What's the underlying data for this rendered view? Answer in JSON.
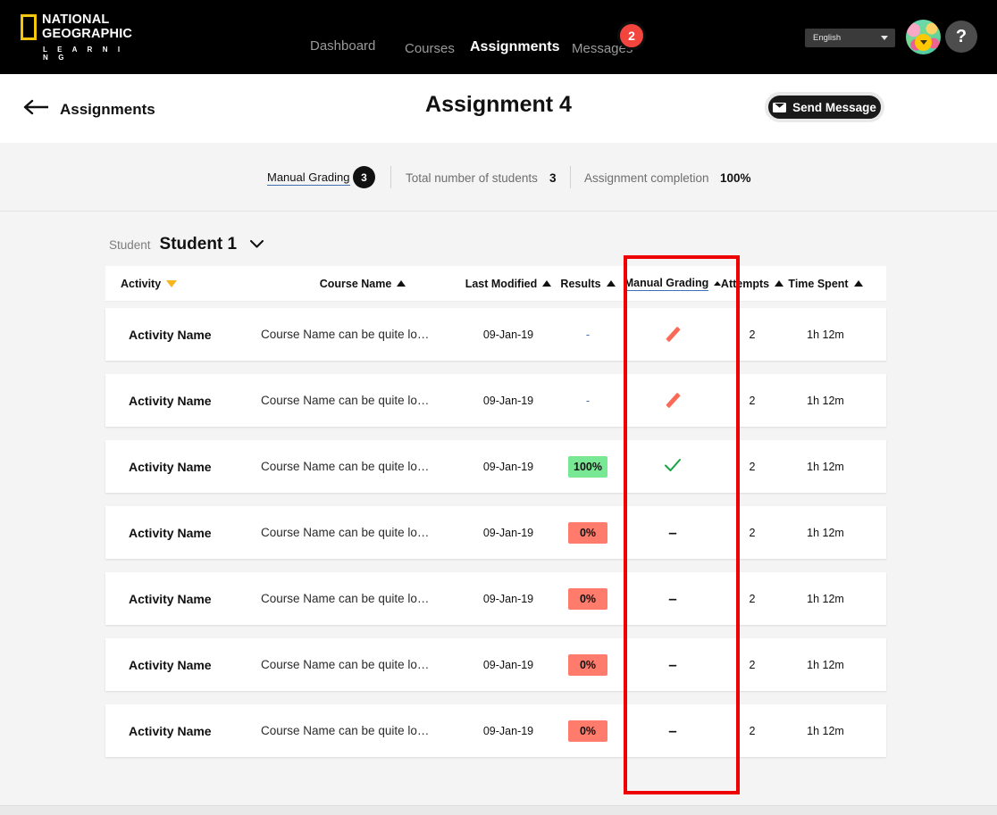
{
  "topnav": {
    "logo": {
      "line1": "NATIONAL",
      "line2": "GEOGRAPHIC",
      "line3": "L E A R N I N G",
      "mark": "ng-logo-icon"
    },
    "links": [
      {
        "label": "Dashboard",
        "active": false
      },
      {
        "label": "Courses",
        "active": false
      },
      {
        "label": "Assignments",
        "active": true
      },
      {
        "label": "Messages",
        "active": false
      }
    ],
    "messages_badge": "2",
    "language": {
      "value": "English",
      "caret": "chevron-down-icon"
    },
    "avatar": {
      "name": "user-avatar",
      "caret": "chevron-down-icon"
    },
    "help": "?"
  },
  "subheader": {
    "back_icon": "arrow-left-icon",
    "back_label": "Assignments",
    "title": "Assignment 4",
    "send_message": {
      "label": "Send Message",
      "icon": "envelope-icon"
    }
  },
  "stats": {
    "manual_grading_label": "Manual Grading",
    "manual_grading_count": "3",
    "total_students_label": "Total number of students",
    "total_students_value": "3",
    "completion_label": "Assignment completion",
    "completion_value": "100%"
  },
  "student_selector": {
    "label": "Student",
    "value": "Student 1",
    "caret": "chevron-down-icon"
  },
  "table": {
    "columns": [
      {
        "label": "Activity",
        "sort": "desc",
        "sort_icon": "triangle-down-icon"
      },
      {
        "label": "Course Name",
        "sort": "asc",
        "sort_icon": "triangle-up-icon"
      },
      {
        "label": "Last Modified",
        "sort": "asc",
        "sort_icon": "triangle-up-icon"
      },
      {
        "label": "Results",
        "sort": "asc",
        "sort_icon": "triangle-up-icon"
      },
      {
        "label": "Manual Grading",
        "sort": "asc",
        "sort_icon": "triangle-up-icon"
      },
      {
        "label": "Attempts",
        "sort": "asc",
        "sort_icon": "triangle-up-icon"
      },
      {
        "label": "Time Spent",
        "sort": "asc",
        "sort_icon": "triangle-up-icon"
      }
    ],
    "rows": [
      {
        "activity": "Activity Name",
        "course": "Course Name can be quite lo…",
        "modified": "09-Jan-19",
        "results": "-",
        "results_type": "dash",
        "manual": "pencil-icon",
        "manual_type": "pencil",
        "attempts": "2",
        "time": "1h 12m"
      },
      {
        "activity": "Activity Name",
        "course": "Course Name can be quite lo…",
        "modified": "09-Jan-19",
        "results": "-",
        "results_type": "dash",
        "manual": "pencil-icon",
        "manual_type": "pencil",
        "attempts": "2",
        "time": "1h 12m"
      },
      {
        "activity": "Activity Name",
        "course": "Course Name can be quite lo…",
        "modified": "09-Jan-19",
        "results": "100%",
        "results_type": "green",
        "manual": "check-icon",
        "manual_type": "check",
        "attempts": "2",
        "time": "1h 12m"
      },
      {
        "activity": "Activity Name",
        "course": "Course Name can be quite lo…",
        "modified": "09-Jan-19",
        "results": "0%",
        "results_type": "red",
        "manual": "–",
        "manual_type": "dash",
        "attempts": "2",
        "time": "1h 12m"
      },
      {
        "activity": "Activity Name",
        "course": "Course Name can be quite lo…",
        "modified": "09-Jan-19",
        "results": "0%",
        "results_type": "red",
        "manual": "–",
        "manual_type": "dash",
        "attempts": "2",
        "time": "1h 12m"
      },
      {
        "activity": "Activity Name",
        "course": "Course Name can be quite lo…",
        "modified": "09-Jan-19",
        "results": "0%",
        "results_type": "red",
        "manual": "–",
        "manual_type": "dash",
        "attempts": "2",
        "time": "1h 12m"
      },
      {
        "activity": "Activity Name",
        "course": "Course Name can be quite lo…",
        "modified": "09-Jan-19",
        "results": "0%",
        "results_type": "red",
        "manual": "–",
        "manual_type": "dash",
        "attempts": "2",
        "time": "1h 12m"
      }
    ]
  },
  "annotation": {
    "name": "manual-grading-column-highlight",
    "color": "#ee0000"
  },
  "colors": {
    "accent_yellow": "#f5c60c",
    "badge_red": "#f2453d",
    "results_green": "#79e895",
    "results_red": "#ff7b6b",
    "check_green": "#17a445",
    "pencil_red": "#fa6a57",
    "nav_black": "#000000"
  }
}
